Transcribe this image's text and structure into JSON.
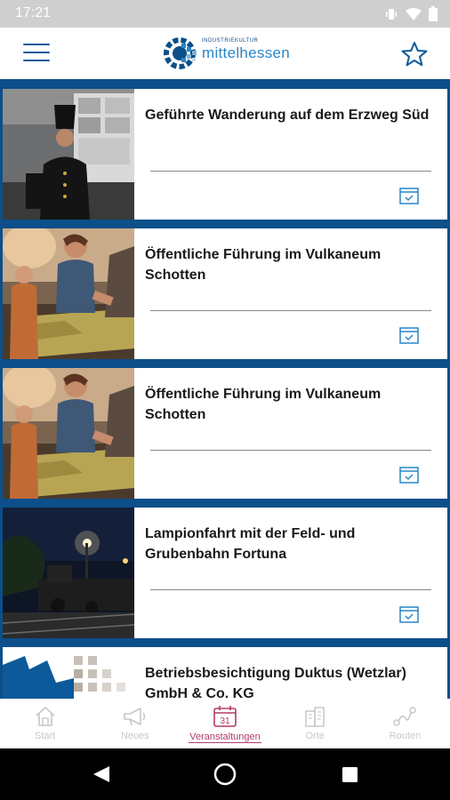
{
  "status_bar": {
    "time": "17:21",
    "icons": [
      "vibrate-icon",
      "wifi-icon",
      "battery-icon"
    ]
  },
  "header": {
    "logo_small": "INDUSTRIEKULTUR",
    "logo_main": "mittelhessen",
    "icons": [
      "menu-icon",
      "star-icon"
    ]
  },
  "events": [
    {
      "title": "Geführte Wanderung auf dem Erzweg Süd",
      "image": "miner-figure-photo"
    },
    {
      "title": "Öffentliche Führung im Vulkaneum Schotten",
      "image": "family-at-map-table-photo"
    },
    {
      "title": "Öffentliche Führung im Vulkaneum Schotten",
      "image": "family-at-map-table-photo"
    },
    {
      "title": "Lampionfahrt mit der Feld- und Grubenbahn Fortuna",
      "image": "night-train-photo"
    },
    {
      "title": "Betriebsbesichtigung Duktus (Wetzlar) GmbH & Co. KG",
      "image": "logo-placeholder-image"
    }
  ],
  "bottom_nav": {
    "items": [
      {
        "label": "Start",
        "icon": "home-icon"
      },
      {
        "label": "Neues",
        "icon": "megaphone-icon"
      },
      {
        "label": "Veranstaltungen",
        "icon": "calendar-icon"
      },
      {
        "label": "Orte",
        "icon": "buildings-icon"
      },
      {
        "label": "Routen",
        "icon": "route-icon"
      }
    ],
    "active_index": 2
  },
  "colors": {
    "brand_blue": "#0c4f8a",
    "accent_blue": "#2a86c8",
    "active_nav": "#b03b6a",
    "inactive_nav": "#c7c7c7"
  }
}
